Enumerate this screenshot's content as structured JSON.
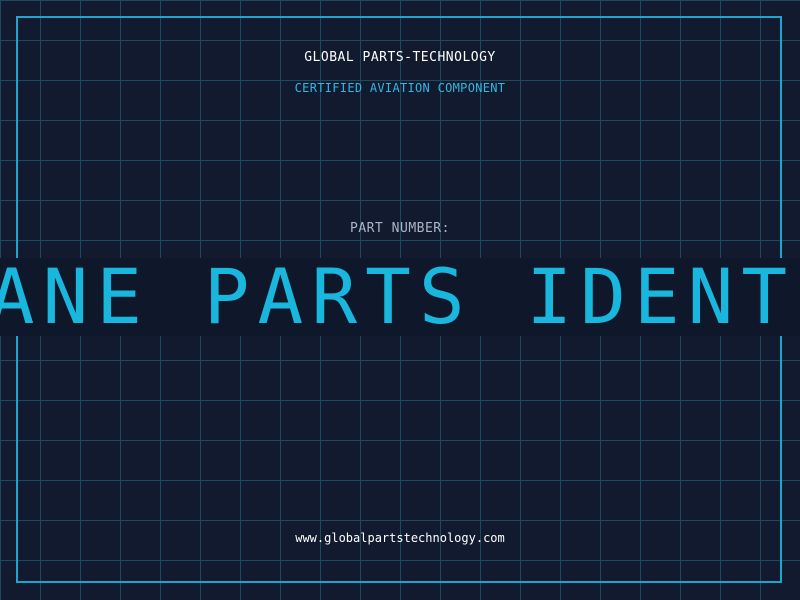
{
  "header": {
    "company": "GLOBAL PARTS-TECHNOLOGY",
    "subtitle": "CERTIFIED AVIATION COMPONENT"
  },
  "part": {
    "label": "PART NUMBER:",
    "value": "AIRPLANE PARTS IDENTIFICATION"
  },
  "footer": {
    "url": "www.globalpartstechnology.com"
  },
  "colors": {
    "background": "#111a2e",
    "grid": "#1d4a5e",
    "accent": "#19b7de",
    "frame": "#1aa7cf"
  }
}
